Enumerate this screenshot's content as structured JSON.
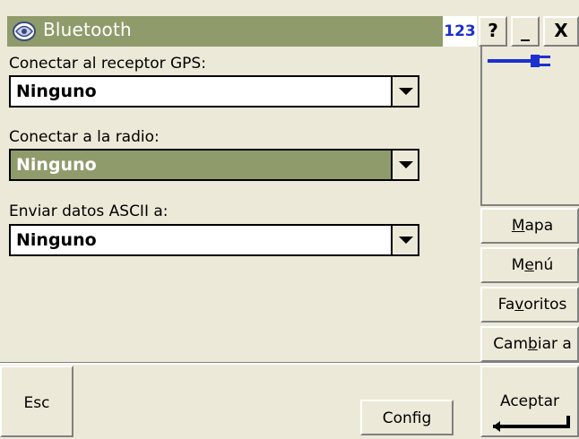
{
  "window": {
    "title": "Bluetooth",
    "input_mode": "123",
    "help_label": "?",
    "minimize_label": "_",
    "close_label": "X"
  },
  "form": {
    "gps": {
      "label": "Conectar al receptor GPS:",
      "value": "Ninguno"
    },
    "radio": {
      "label": "Conectar a la radio:",
      "value": "Ninguno"
    },
    "ascii": {
      "label": "Enviar datos ASCII a:",
      "value": "Ninguno"
    }
  },
  "status": {
    "connection_icon": "plug-icon"
  },
  "side_menu": {
    "map": {
      "label": "Mapa",
      "pre": "",
      "key": "M",
      "post": "apa"
    },
    "menu": {
      "label": "Menú",
      "pre": "M",
      "key": "e",
      "post": "nú"
    },
    "favorites": {
      "label": "Favoritos",
      "pre": "Fa",
      "key": "v",
      "post": "oritos"
    },
    "switch": {
      "label": "Cambiar a",
      "pre": "Cam",
      "key": "b",
      "post": "iar a"
    }
  },
  "bottom": {
    "esc_label": "Esc",
    "config_label": "Config",
    "accept_label": "Aceptar"
  },
  "colors": {
    "accent": "#8f9b6b",
    "background": "#ece9d8",
    "input_mode_text": "#1c2fd0",
    "plug_icon": "#1c2fd0"
  }
}
